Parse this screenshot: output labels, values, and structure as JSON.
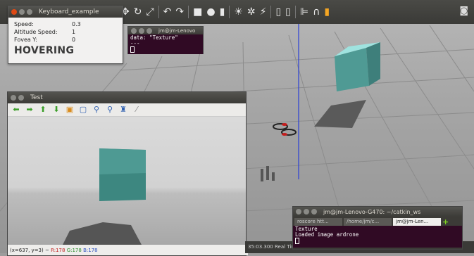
{
  "gazebo": {
    "toolbar_icons": [
      "move-icon",
      "rotate-icon",
      "scale-icon",
      "undo-icon",
      "redo-icon",
      "box-icon",
      "sphere-icon",
      "cylinder-icon",
      "sun-icon",
      "point-light-icon",
      "spot-light-icon",
      "copy-icon",
      "paste-icon",
      "align-icon",
      "snap-icon",
      "color-icon"
    ],
    "status": {
      "sim_time": "35:03.300",
      "real_time_label": "Real Time",
      "right_label": "Re"
    }
  },
  "keyboard_window": {
    "title": "Keyboard_example",
    "rows": [
      {
        "label": "Speed:",
        "value": "0.3"
      },
      {
        "label": "Altitude Speed:",
        "value": "1"
      },
      {
        "label": "Fovea Y:",
        "value": "0"
      }
    ],
    "status": "HOVERING"
  },
  "terminal_top": {
    "title": "jm@jm-Lenovo",
    "lines": [
      "data: \"Texture\"",
      "---"
    ]
  },
  "test_window": {
    "title": "Test",
    "toolbar": [
      "arrow-left-icon",
      "arrow-right-icon",
      "arrow-up-icon",
      "arrow-down-icon",
      "save-icon",
      "fit-icon",
      "zoom-in-icon",
      "zoom-out-icon",
      "binoculars-icon",
      "brush-icon"
    ],
    "status": {
      "coords": "(x=637, y=3) ~",
      "r": "R:178",
      "g": "G:178",
      "b": "B:178"
    }
  },
  "terminal_bottom": {
    "title": "jm@jm-Lenovo-G470: ~/catkin_ws",
    "tabs": [
      {
        "label": "roscore htt...",
        "active": false
      },
      {
        "label": "/home/jm/c...",
        "active": false
      },
      {
        "label": "jm@jm-Len...",
        "active": true
      }
    ],
    "lines": [
      "Texture",
      "Loaded image ardrone"
    ]
  }
}
